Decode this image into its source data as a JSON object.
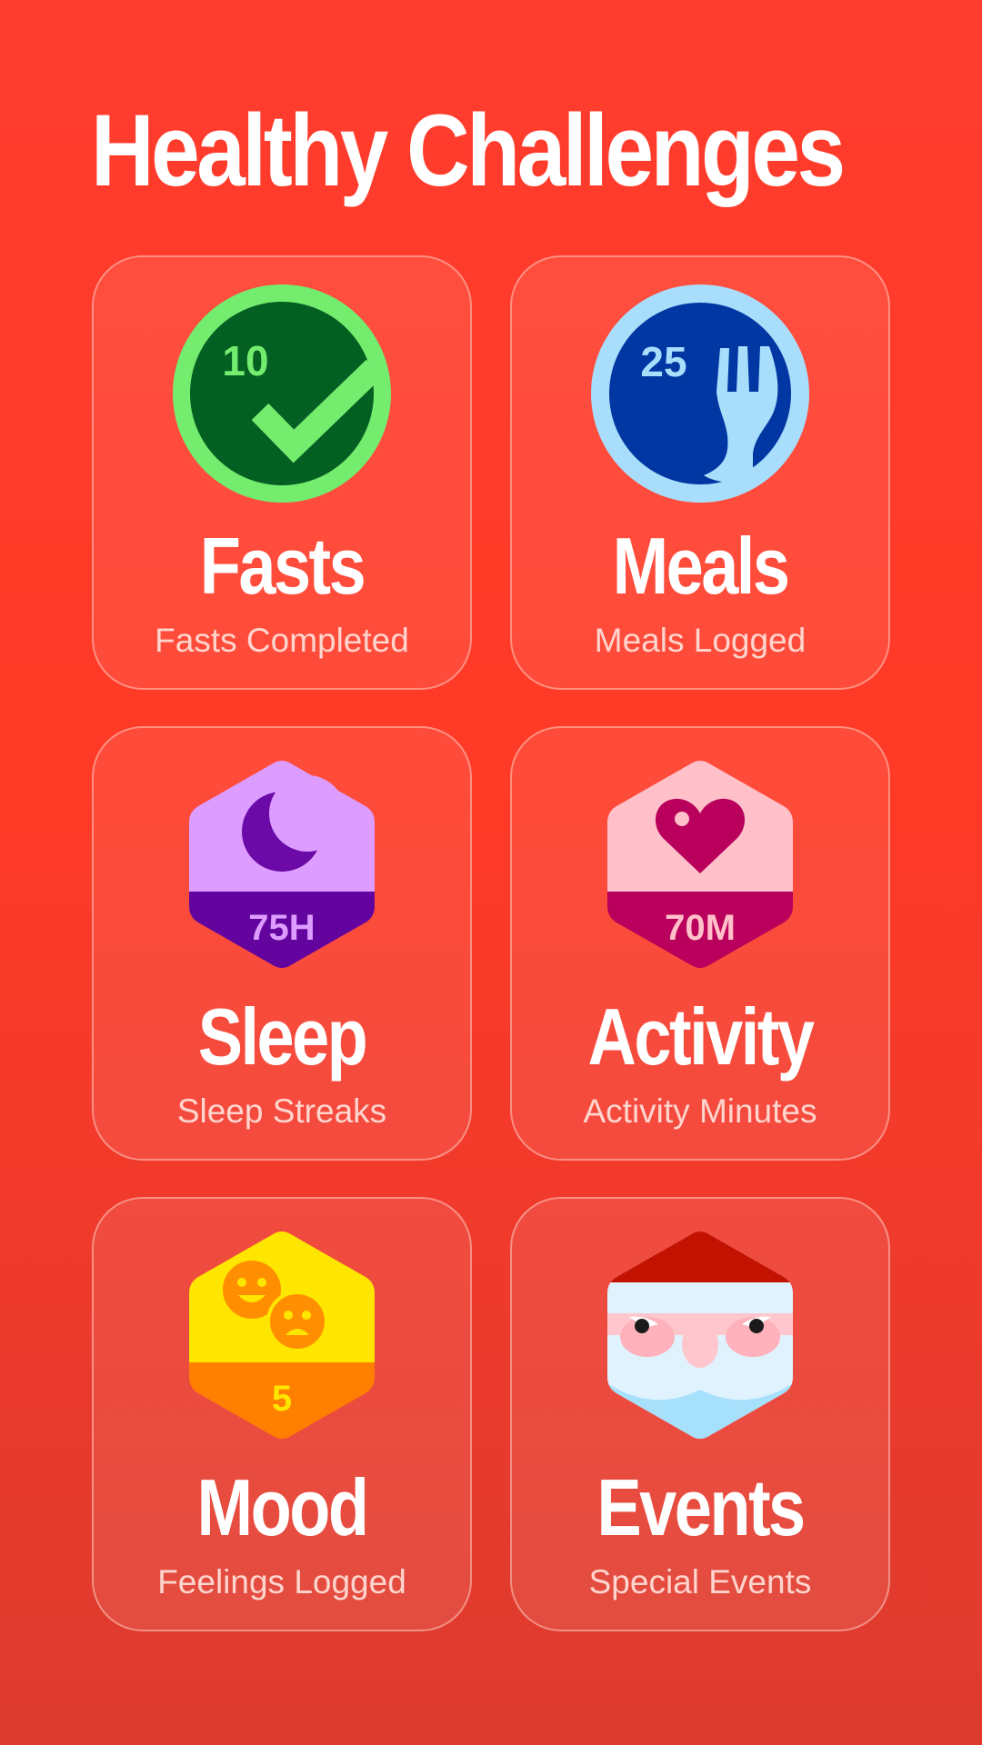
{
  "page": {
    "title": "Healthy Challenges",
    "background_color": "#ff3a26"
  },
  "cards": [
    {
      "title": "Fasts",
      "subtitle": "Fasts Completed",
      "badge_value": "10",
      "icon": "checkmark-badge-icon",
      "colors": {
        "ring": "#74ec6e",
        "fill": "#045f22",
        "accent": "#74ec6e"
      }
    },
    {
      "title": "Meals",
      "subtitle": "Meals Logged",
      "badge_value": "25",
      "icon": "fork-badge-icon",
      "colors": {
        "ring": "#a8defb",
        "fill": "#0037a3",
        "accent": "#a8defb"
      }
    },
    {
      "title": "Sleep",
      "subtitle": "Sleep Streaks",
      "badge_value": "75H",
      "icon": "moon-badge-icon",
      "colors": {
        "top": "#dd9cff",
        "bottom": "#63049e",
        "accent": "#6b0aa6",
        "text": "#dd9cff"
      }
    },
    {
      "title": "Activity",
      "subtitle": "Activity Minutes",
      "badge_value": "70M",
      "icon": "heart-badge-icon",
      "colors": {
        "top": "#ffc0ca",
        "bottom": "#b8005c",
        "accent": "#b8005c",
        "text": "#ffc0ca"
      }
    },
    {
      "title": "Mood",
      "subtitle": "Feelings Logged",
      "badge_value": "5",
      "icon": "smiley-badge-icon",
      "colors": {
        "top": "#ffe600",
        "bottom": "#ff7f00",
        "accent": "#ff8f00",
        "text": "#ffe600"
      }
    },
    {
      "title": "Events",
      "subtitle": "Special Events",
      "icon": "santa-badge-icon",
      "colors": {
        "hat": "#c41200",
        "face": "#dff2fe",
        "skin": "#ffc7cd",
        "beard": "#a6e0fb"
      }
    }
  ]
}
